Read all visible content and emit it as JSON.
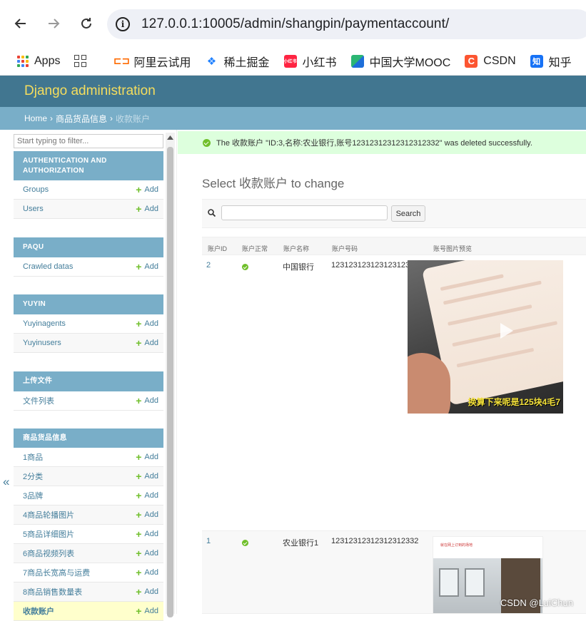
{
  "browser": {
    "url": "127.0.0.1:10005/admin/shangpin/paymentaccount/",
    "bookmarks": [
      {
        "label": "Apps",
        "icon": "apps-grid-icon"
      },
      {
        "label": "",
        "icon": "tab-groups-icon"
      },
      {
        "label": "阿里云试用",
        "icon": "aliyun-icon",
        "color": "#ff6a00"
      },
      {
        "label": "稀土掘金",
        "icon": "juejin-icon",
        "color": "#1e80ff"
      },
      {
        "label": "小红书",
        "icon": "xiaohongshu-icon",
        "color": "#ff2442"
      },
      {
        "label": "中国大学MOOC",
        "icon": "mooc-icon",
        "color": "#2bb673"
      },
      {
        "label": "CSDN",
        "icon": "csdn-icon",
        "color": "#fc5531"
      },
      {
        "label": "知乎",
        "icon": "zhihu-icon",
        "color": "#1772f6"
      }
    ]
  },
  "header": {
    "brand": "Django administration"
  },
  "breadcrumbs": {
    "home": "Home",
    "app": "商品货品信息",
    "current": "收款账户"
  },
  "sidebar": {
    "filter_placeholder": "Start typing to filter...",
    "add_label": "Add",
    "modules": [
      {
        "caption": "AUTHENTICATION AND AUTHORIZATION",
        "items": [
          "Groups",
          "Users"
        ]
      },
      {
        "caption": "PAQU",
        "items": [
          "Crawled datas"
        ]
      },
      {
        "caption": "YUYIN",
        "items": [
          "Yuyinagents",
          "Yuyinusers"
        ]
      },
      {
        "caption": "上传文件",
        "items": [
          "文件列表"
        ]
      },
      {
        "caption": "商品货品信息",
        "items": [
          "1商品",
          "2分类",
          "3品牌",
          "4商品轮播图片",
          "5商品详细图片",
          "6商品视频列表",
          "7商品长宽高与运费",
          "8商品销售数量表",
          "收款账户"
        ]
      }
    ]
  },
  "message": "The 收款账户 \"ID:3,名称:农业银行,账号12312312312312312332\" was deleted successfully.",
  "page_title": "Select 收款账户 to change",
  "search": {
    "button": "Search",
    "value": ""
  },
  "table": {
    "headers": [
      "账户ID",
      "账户正常",
      "账户名称",
      "账户号码",
      "账号图片预览"
    ],
    "rows": [
      {
        "id": "2",
        "active": true,
        "name": "中国银行",
        "number": "12312312312312312332",
        "thumb_caption": "换算下来呢是125块4毛7"
      },
      {
        "id": "1",
        "active": true,
        "name": "农业银行1",
        "number": "12312312312312312332",
        "thumb_caption": "就在网上订到的场地"
      }
    ]
  },
  "watermark": "CSDN @LuiChun",
  "colors": {
    "header": "#417690",
    "breadcrumbs": "#79aec8",
    "brand": "#f5dd5d",
    "link": "#447e9b",
    "success_bg": "#ddffdd"
  }
}
